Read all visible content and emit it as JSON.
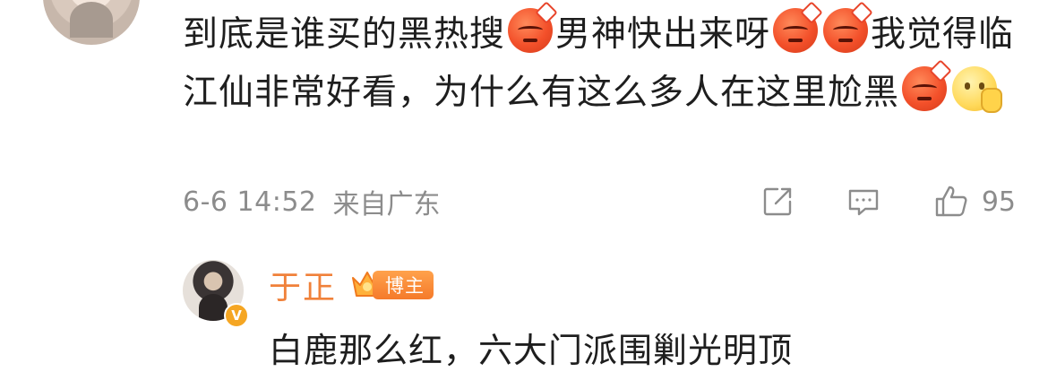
{
  "comment": {
    "segments": [
      {
        "type": "text",
        "value": "到底是谁买的黑热搜"
      },
      {
        "type": "emoji",
        "name": "angry-face-emoji"
      },
      {
        "type": "text",
        "value": "男神快出来呀"
      },
      {
        "type": "emoji",
        "name": "angry-face-emoji"
      },
      {
        "type": "emoji",
        "name": "angry-face-emoji"
      },
      {
        "type": "text",
        "value": "我觉得临江仙非常好看，为什么有这么多人在这里尬黑"
      },
      {
        "type": "emoji",
        "name": "angry-face-emoji"
      },
      {
        "type": "emoji",
        "name": "thinking-face-emoji"
      }
    ],
    "time": "6-6 14:52",
    "location": "来自广东",
    "like_count": "95"
  },
  "reply": {
    "author": "于正",
    "badge": "博主",
    "text": "白鹿那么红，六大门派围剿光明顶"
  },
  "colors": {
    "author_name": "#f0813a",
    "meta_text": "#8c8c8c",
    "badge_bg": "#f57a2a"
  }
}
